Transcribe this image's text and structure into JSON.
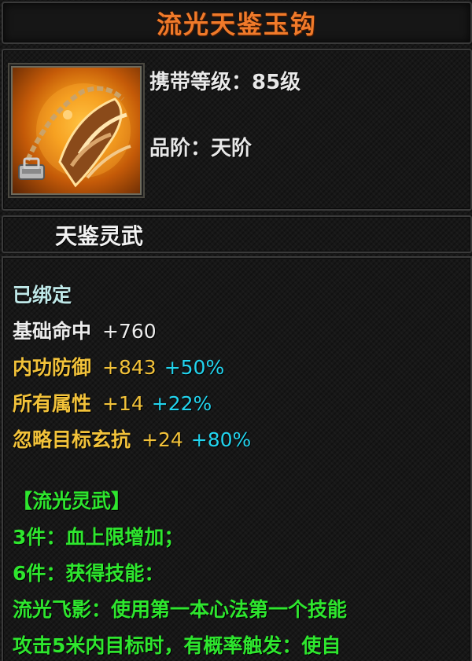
{
  "item": {
    "name": "流光天鉴玉钩",
    "carry_level": "携带等级：85级",
    "grade": "品阶：天阶",
    "category": "天鉴灵武",
    "icon": "golden-claw-hook-icon",
    "bind_icon": "lock-badge-icon"
  },
  "stats": {
    "bound": "已绑定",
    "base": {
      "label": "基础命中",
      "value": "+760"
    },
    "attrs": [
      {
        "label": "内功防御",
        "value": "+843",
        "pct": "+50%"
      },
      {
        "label": "所有属性",
        "value": "+14",
        "pct": "+22%"
      },
      {
        "label": "忽略目标玄抗",
        "value": "+24",
        "pct": "+80%"
      }
    ]
  },
  "set": {
    "title": "【流光灵武】",
    "lines": [
      "3件：血上限增加；",
      "6件：获得技能：",
      "流光飞影：使用第一本心法第一个技能",
      "攻击5米内目标时，有概率触发：使自"
    ]
  },
  "colors": {
    "title": "#f07a2a",
    "gold": "#f2c23a",
    "cyan": "#22d4ee",
    "green": "#2ee62e"
  }
}
